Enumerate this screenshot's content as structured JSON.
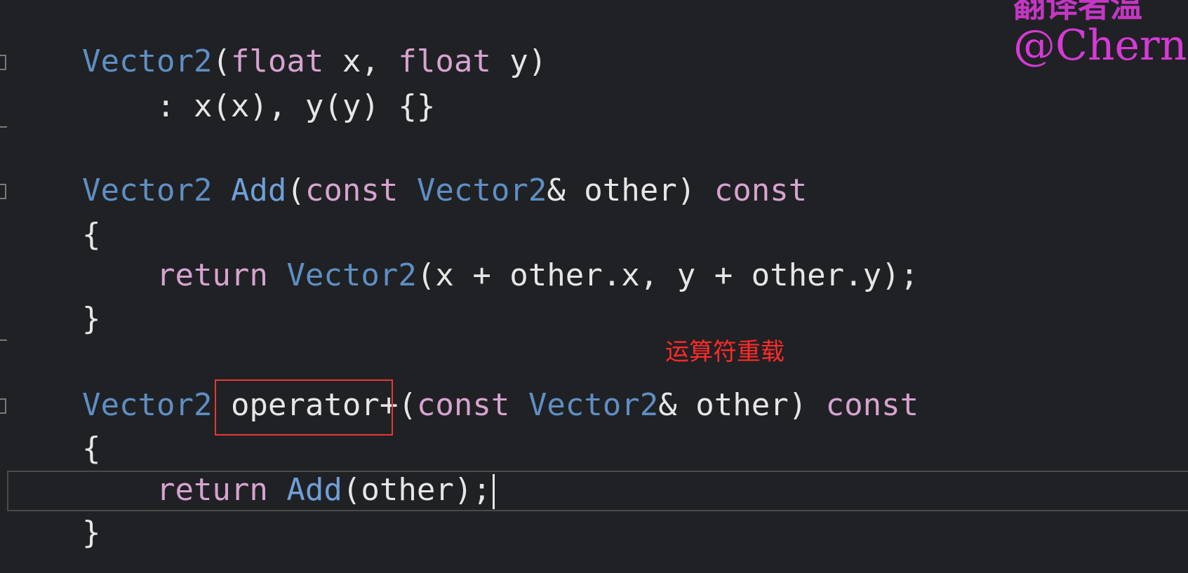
{
  "watermark": {
    "top_text": "翻译者温",
    "handle": "@Chern"
  },
  "annotation": {
    "label": "运算符重载"
  },
  "code": {
    "ctor_type": "Vector2",
    "ctor_paren": "(",
    "ctor_float1": "float",
    "ctor_x": " x, ",
    "ctor_float2": "float",
    "ctor_y": " y)",
    "init_list": "    : x(x), y(y) {}",
    "add_ret_type": "Vector2",
    "add_name": "Add",
    "add_paren": "(",
    "add_const1": "const",
    "add_param_type": "Vector2",
    "add_param": "& other) ",
    "add_const2": "const",
    "brace_open": "{",
    "return_kw": "    return",
    "return_type": "Vector2",
    "return_expr": "(x + other.x, y + other.y);",
    "brace_close": "}",
    "op_ret_type": "Vector2",
    "op_name": "operator+",
    "op_paren": "(",
    "op_const1": "const",
    "op_param_type": "Vector2",
    "op_param": "& other) ",
    "op_const2": "const",
    "brace_open2": "{",
    "return_kw2": "    return",
    "return_call": "Add",
    "return_args": "(other);",
    "brace_close2": "}"
  }
}
